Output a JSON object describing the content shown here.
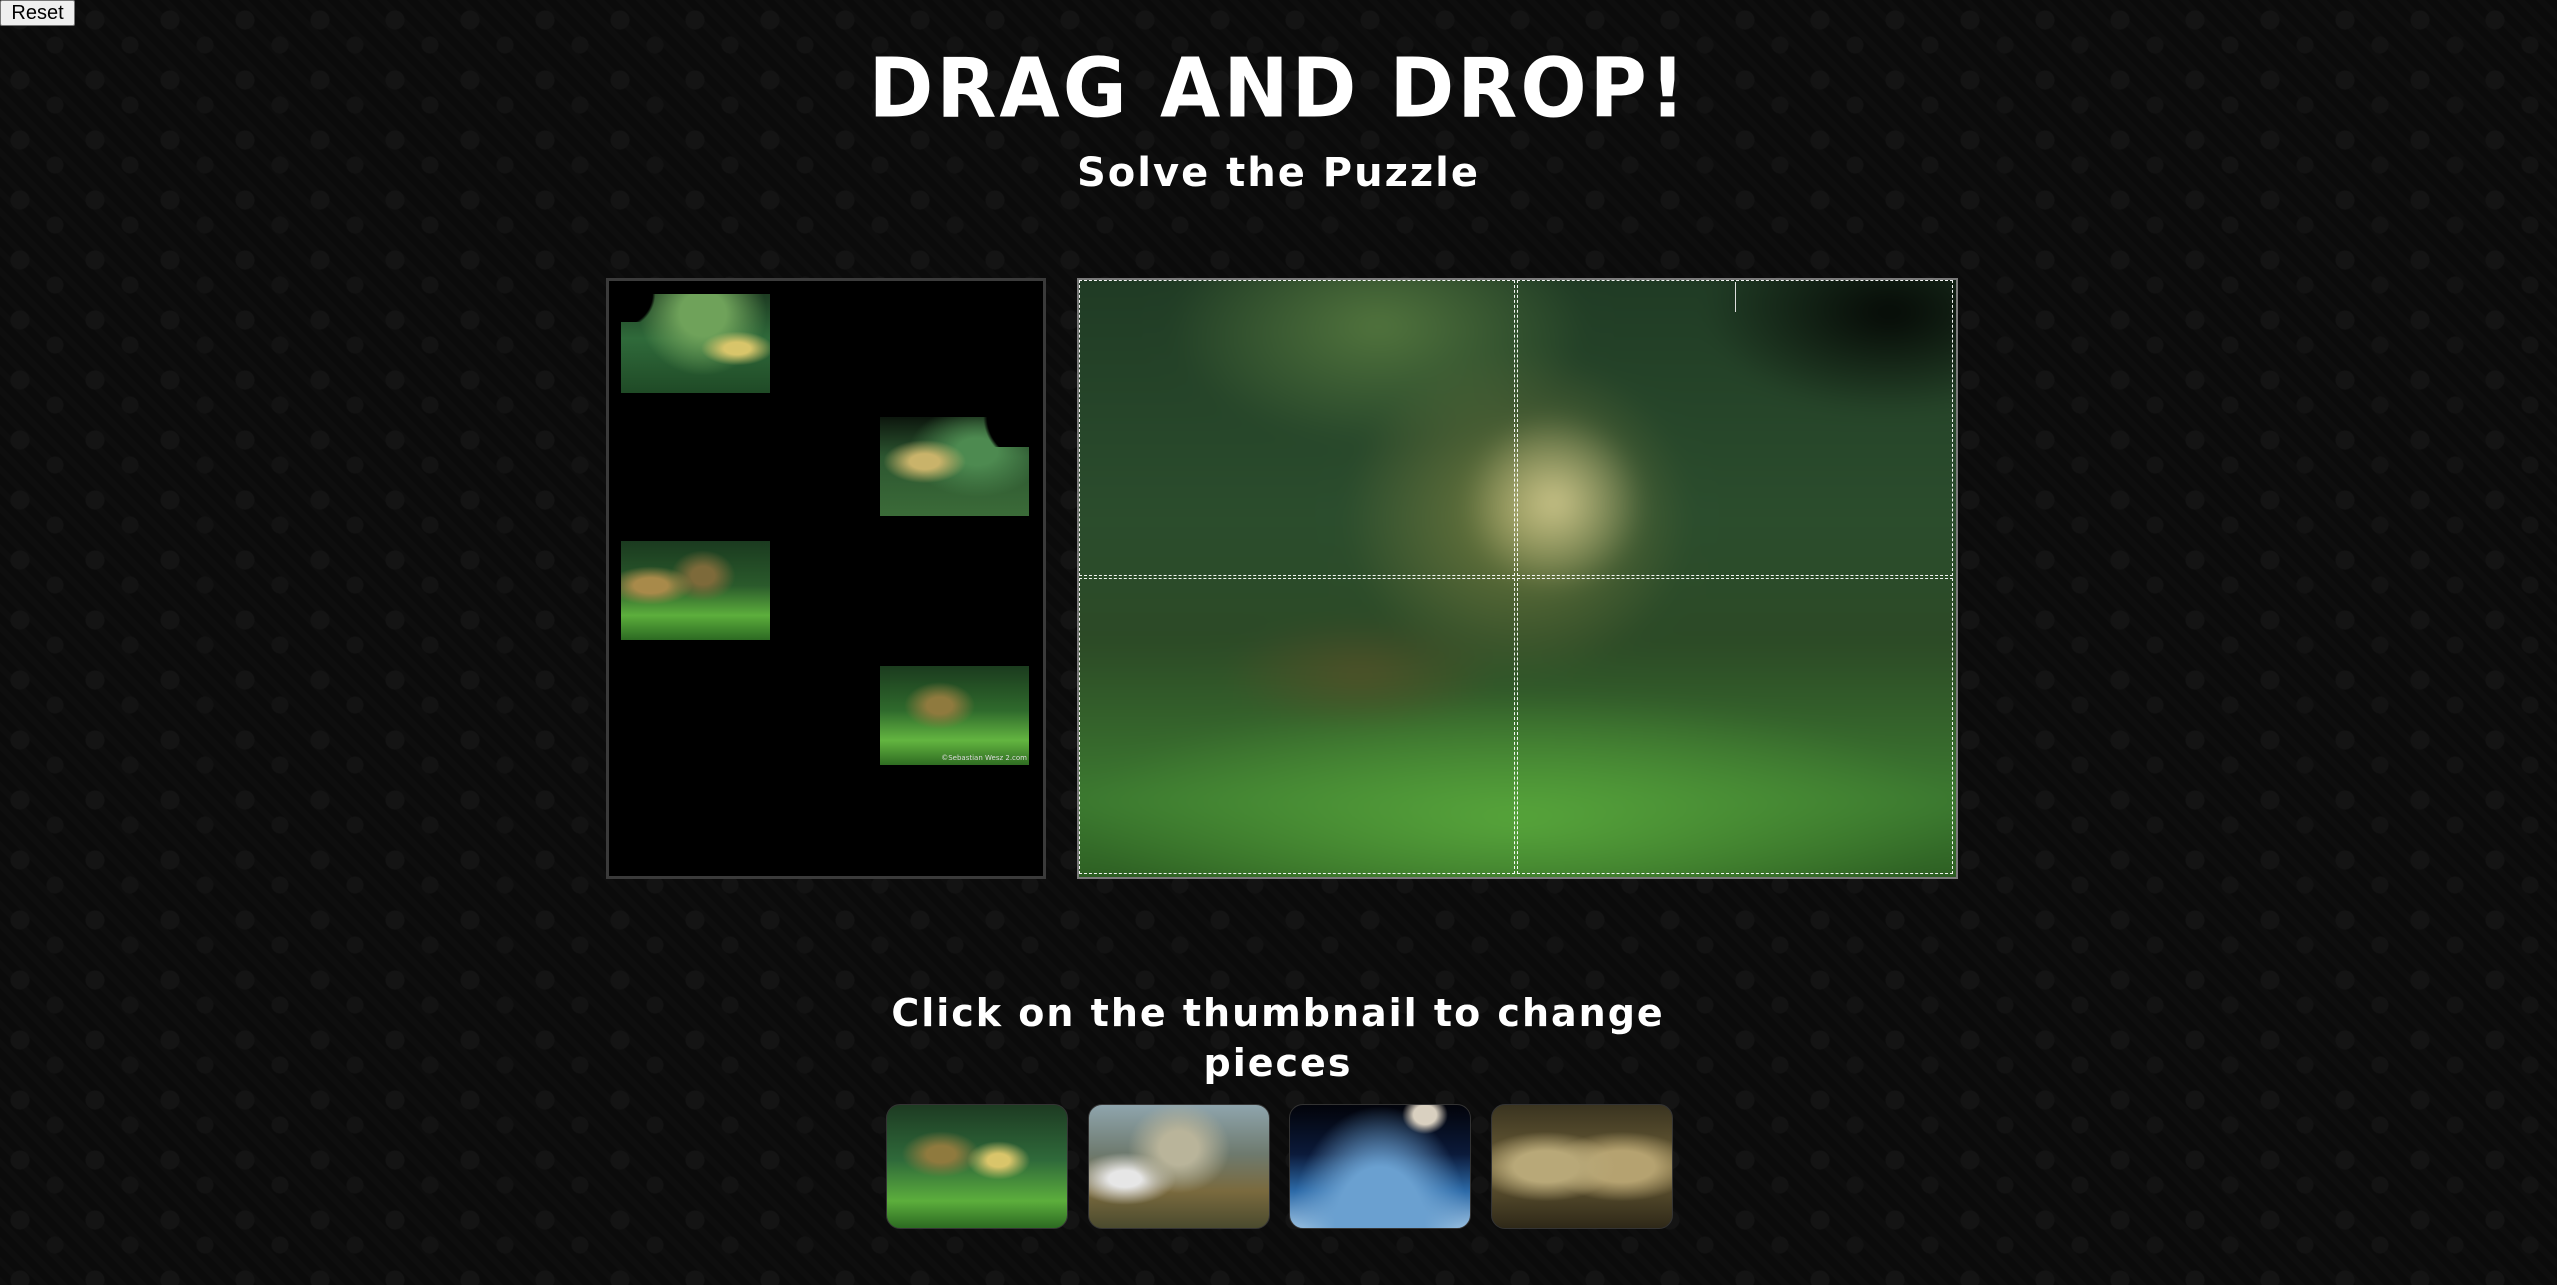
{
  "reset_label": "Reset",
  "header": {
    "title": "DRAG AND DROP!",
    "subtitle": "Solve the Puzzle"
  },
  "pieces": [
    {
      "name": "puzzle-piece-1"
    },
    {
      "name": "puzzle-piece-2"
    },
    {
      "name": "puzzle-piece-3"
    },
    {
      "name": "puzzle-piece-4",
      "watermark": "©Sebastian Wesz 2.com"
    }
  ],
  "instructions": {
    "line1": "Click on the thumbnail to change",
    "line2": "pieces"
  },
  "thumbnails": [
    "forest-scene",
    "mountain-ruins",
    "earth-from-space",
    "mechanical-faces"
  ]
}
